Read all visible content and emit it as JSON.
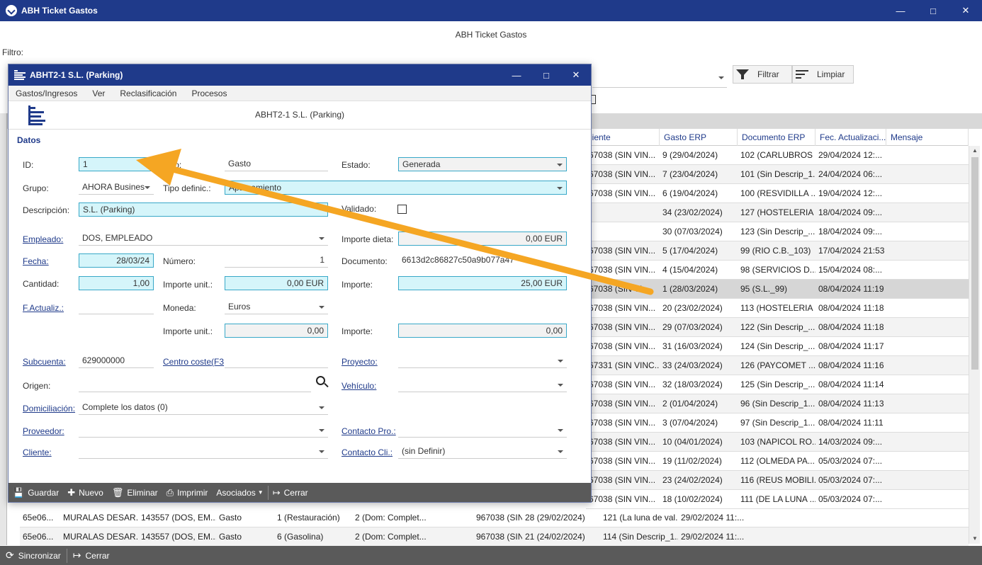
{
  "window": {
    "title": "ABH Ticket Gastos",
    "header": "ABH Ticket Gastos",
    "filtro_label": "Filtro:"
  },
  "toolbar": {
    "filtrar": "Filtrar",
    "limpiar": "Limpiar"
  },
  "grid": {
    "columns": [
      "liente",
      "Gasto ERP",
      "Documento ERP",
      "Fec. Actualizaci...",
      "Mensaje"
    ],
    "rows": [
      [
        "67038 (SIN VIN...",
        "9 (29/04/2024)",
        "102 (CARLUBROS ...",
        "29/04/2024 12:..."
      ],
      [
        "67038 (SIN VIN...",
        "7 (23/04/2024)",
        "101 (Sin Descrip_1...",
        "24/04/2024 06:..."
      ],
      [
        "67038 (SIN VIN...",
        "6 (19/04/2024)",
        "100 (RESVIDILLA ...",
        "19/04/2024 12:..."
      ],
      [
        "",
        "34 (23/02/2024)",
        "127 (HOSTELERIA ...",
        "18/04/2024 09:..."
      ],
      [
        "",
        "30 (07/03/2024)",
        "123 (Sin Descrip_...",
        "18/04/2024 09:..."
      ],
      [
        "67038 (SIN VIN...",
        "5 (17/04/2024)",
        "99 (RIO C.B._103)",
        "17/04/2024 21:53"
      ],
      [
        "67038 (SIN VIN...",
        "4 (15/04/2024)",
        "98 (SERVICIOS D...",
        "15/04/2024 08:..."
      ],
      [
        "67038 (SIN VI...",
        "1 (28/03/2024)",
        "95 (S.L._99)",
        "08/04/2024 11:19"
      ],
      [
        "67038 (SIN VIN...",
        "20 (23/02/2024)",
        "113 (HOSTELERIA ...",
        "08/04/2024 11:18"
      ],
      [
        "67038 (SIN VIN...",
        "29 (07/03/2024)",
        "122 (Sin Descrip_...",
        "08/04/2024 11:18"
      ],
      [
        "67038 (SIN VIN...",
        "31 (16/03/2024)",
        "124 (Sin Descrip_...",
        "08/04/2024 11:17"
      ],
      [
        "67331 (SIN VINC...",
        "33 (24/03/2024)",
        "126 (PAYCOMET ...",
        "08/04/2024 11:16"
      ],
      [
        "67038 (SIN VIN...",
        "32 (18/03/2024)",
        "125 (Sin Descrip_...",
        "08/04/2024 11:14"
      ],
      [
        "67038 (SIN VIN...",
        "2 (01/04/2024)",
        "96 (Sin Descrip_1...",
        "08/04/2024 11:13"
      ],
      [
        "67038 (SIN VIN...",
        "3 (07/04/2024)",
        "97 (Sin Descrip_1...",
        "08/04/2024 11:11"
      ],
      [
        "67038 (SIN VIN...",
        "10 (04/01/2024)",
        "103 (NAPICOL RO...",
        "14/03/2024 09:..."
      ],
      [
        "67038 (SIN VIN...",
        "19 (11/02/2024)",
        "112 (OLMEDA PA...",
        "05/03/2024 07:..."
      ],
      [
        "67038 (SIN VIN...",
        "23 (24/02/2024)",
        "116 (REUS MOBILI...",
        "05/03/2024 07:..."
      ],
      [
        "67038 (SIN VIN...",
        "18 (10/02/2024)",
        "111 (DE LA LUNA ...",
        "05/03/2024 07:..."
      ]
    ],
    "bottom_rows": [
      [
        "65e06...",
        "MURALAS DESAR...",
        "143557 (DOS, EM...",
        "Gasto",
        "1 (Restauración)",
        "2 (Dom: Complet...",
        "967038 (SIN VIN...",
        "28 (29/02/2024)",
        "121 (La luna de val...",
        "29/02/2024 11:..."
      ],
      [
        "65e06...",
        "MURALAS DESAR...",
        "143557 (DOS, EM...",
        "Gasto",
        "6 (Gasolina)",
        "2 (Dom: Complet...",
        "967038 (SIN VIN...",
        "21 (24/02/2024)",
        "114 (Sin Descrip_1...",
        "29/02/2024 11:..."
      ]
    ]
  },
  "statusbar": {
    "sincronizar": "Sincronizar",
    "cerrar": "Cerrar"
  },
  "dialog": {
    "title": "ABHT2-1 S.L. (Parking)",
    "header": "ABHT2-1 S.L. (Parking)",
    "menu": [
      "Gastos/Ingresos",
      "Ver",
      "Reclasificación",
      "Procesos"
    ],
    "section": "Datos",
    "labels": {
      "id": "ID:",
      "tipo": "Tipo:",
      "estado": "Estado:",
      "grupo": "Grupo:",
      "tipo_defini": "Tipo definic.:",
      "descripcion": "Descripción:",
      "validado": "Validado:",
      "empleado": "Empleado:",
      "importe_dieta": "Importe dieta:",
      "fecha": "Fecha:",
      "numero": "Número:",
      "documento": "Documento:",
      "cantidad": "Cantidad:",
      "importe_unit": "Importe unit.:",
      "importe": "Importe:",
      "f_actualiz": "F.Actualiz.:",
      "moneda": "Moneda:",
      "importe_unit2": "Importe unit.:",
      "importe2": "Importe:",
      "subcuenta": "Subcuenta:",
      "centro_coste": "Centro coste(F3",
      "proyecto": "Proyecto:",
      "origen": "Origen:",
      "vehiculo": "Vehículo:",
      "domiciliacion": "Domiciliación:",
      "proveedor": "Proveedor:",
      "contacto_pro": "Contacto Pro.:",
      "cliente": "Cliente:",
      "contacto_cli": "Contacto Cli.:"
    },
    "values": {
      "id": "1",
      "tipo": "Gasto",
      "estado": "Generada",
      "grupo": "AHORA Busines",
      "tipo_defini": "Aparcamiento",
      "descripcion": "S.L. (Parking)",
      "empleado": "DOS, EMPLEADO",
      "importe_dieta": "0,00 EUR",
      "fecha": "28/03/24",
      "numero": "1",
      "documento": "6613d2c86827c50a9b077a47",
      "cantidad": "1,00",
      "importe_unit": "0,00 EUR",
      "importe": "25,00 EUR",
      "moneda": "Euros",
      "importe_unit2": "0,00",
      "importe2": "0,00",
      "subcuenta": "629000000",
      "domiciliacion": "Complete los datos (0)",
      "contacto_cli": "(sin Definir)"
    },
    "toolbar": [
      "Guardar",
      "Nuevo",
      "Eliminar",
      "Imprimir",
      "Asociados",
      "Cerrar"
    ]
  },
  "colors": {
    "accent": "#1f3a8a",
    "field_blue": "#d5f5fa",
    "arrow": "#f5a623"
  }
}
